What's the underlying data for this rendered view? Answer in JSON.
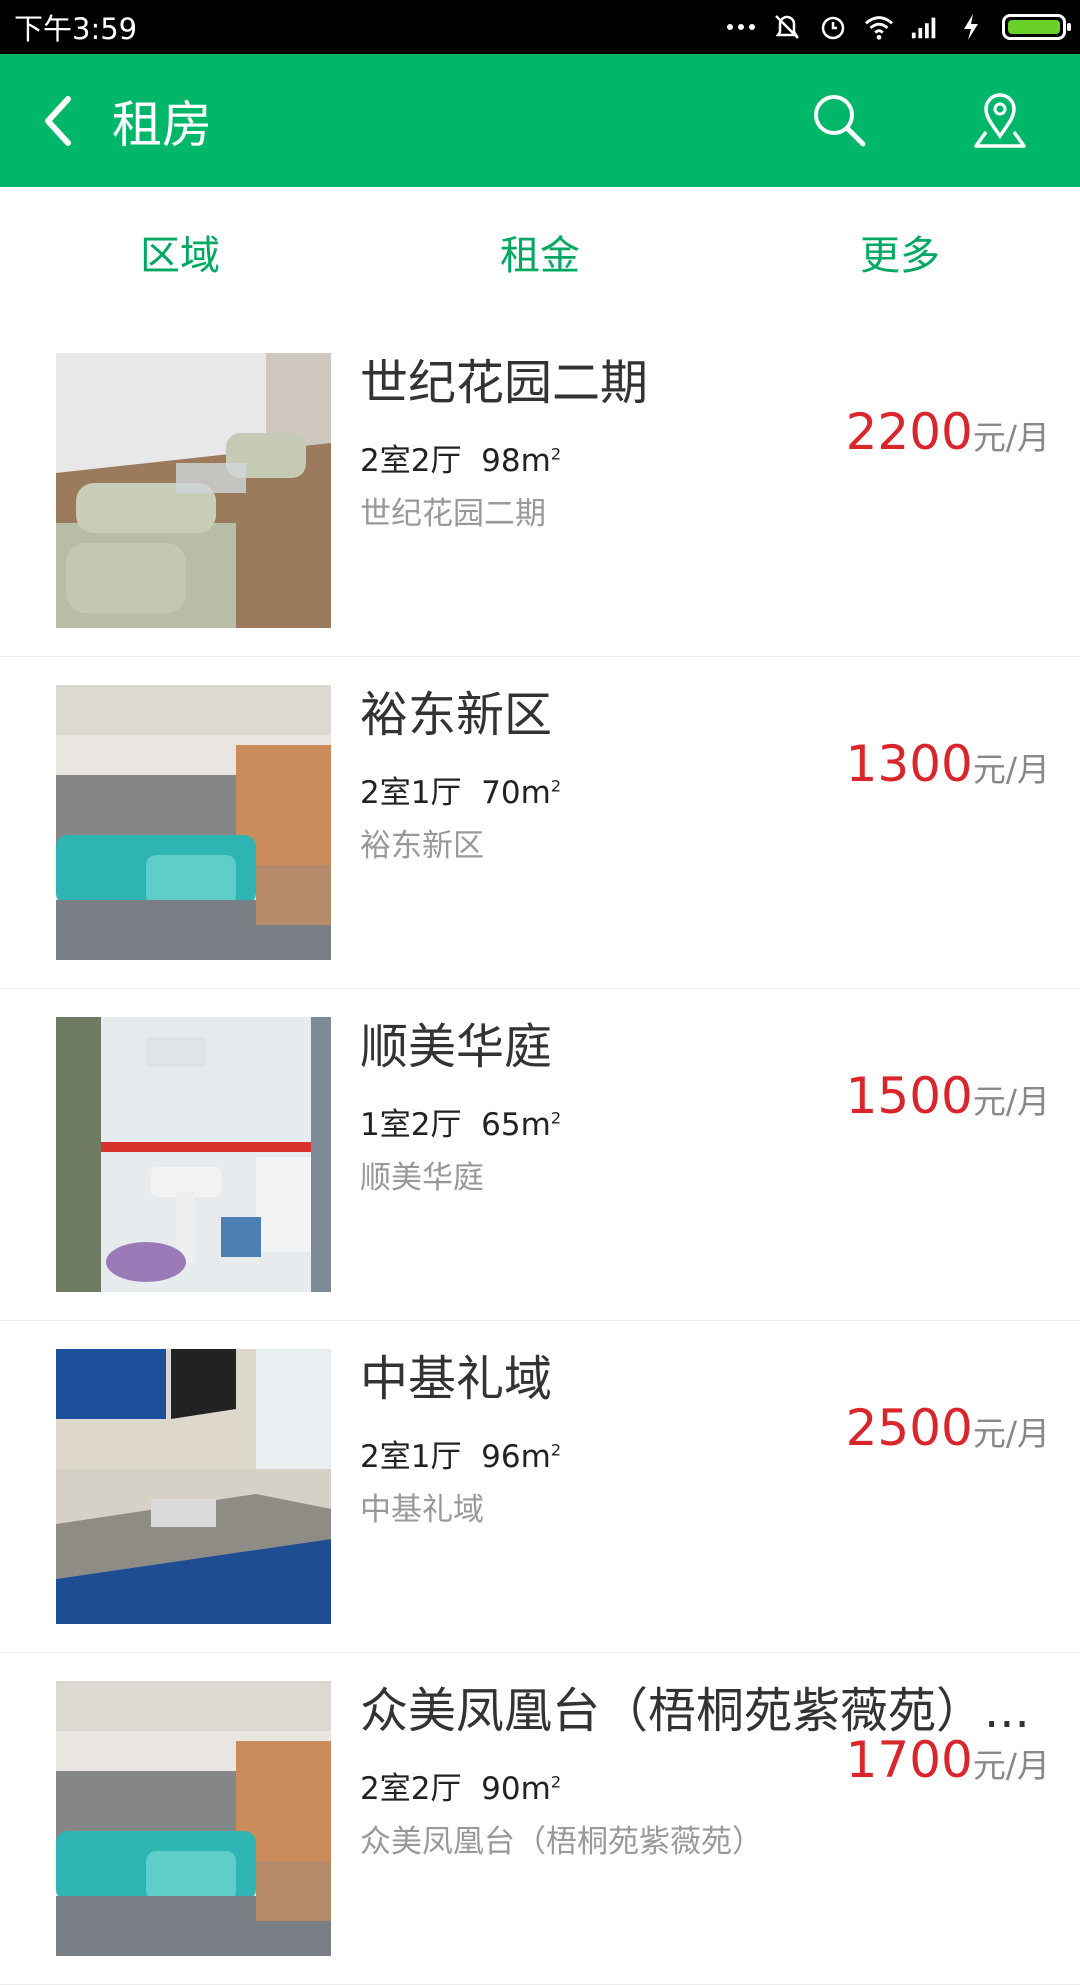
{
  "status_bar": {
    "time": "下午3:59"
  },
  "app_bar": {
    "title": "租房"
  },
  "filters": [
    "区域",
    "租金",
    "更多"
  ],
  "colors": {
    "brand": "#00b769",
    "filter_text": "#00a862",
    "price": "#d9262c"
  },
  "price_unit": "元/月",
  "listings": [
    {
      "name": "世纪花园二期",
      "layout": "2室2厅",
      "area": "98m",
      "community": "世纪花园二期",
      "price": "2200",
      "photo": "living-room-sofa"
    },
    {
      "name": "裕东新区",
      "layout": "2室1厅",
      "area": "70m",
      "community": "裕东新区",
      "price": "1300",
      "photo": "living-room-blurred"
    },
    {
      "name": "顺美华庭",
      "layout": "1室2厅",
      "area": "65m",
      "community": "顺美华庭",
      "price": "1500",
      "photo": "bathroom"
    },
    {
      "name": "中基礼域",
      "layout": "2室1厅",
      "area": "96m",
      "community": "中基礼域",
      "price": "2500",
      "photo": "kitchen"
    },
    {
      "name": "众美凤凰台（梧桐苑紫薇苑）...",
      "layout": "2室2厅",
      "area": "90m",
      "community": "众美凤凰台（梧桐苑紫薇苑）",
      "price": "1700",
      "photo": "living-room-blurred"
    }
  ]
}
